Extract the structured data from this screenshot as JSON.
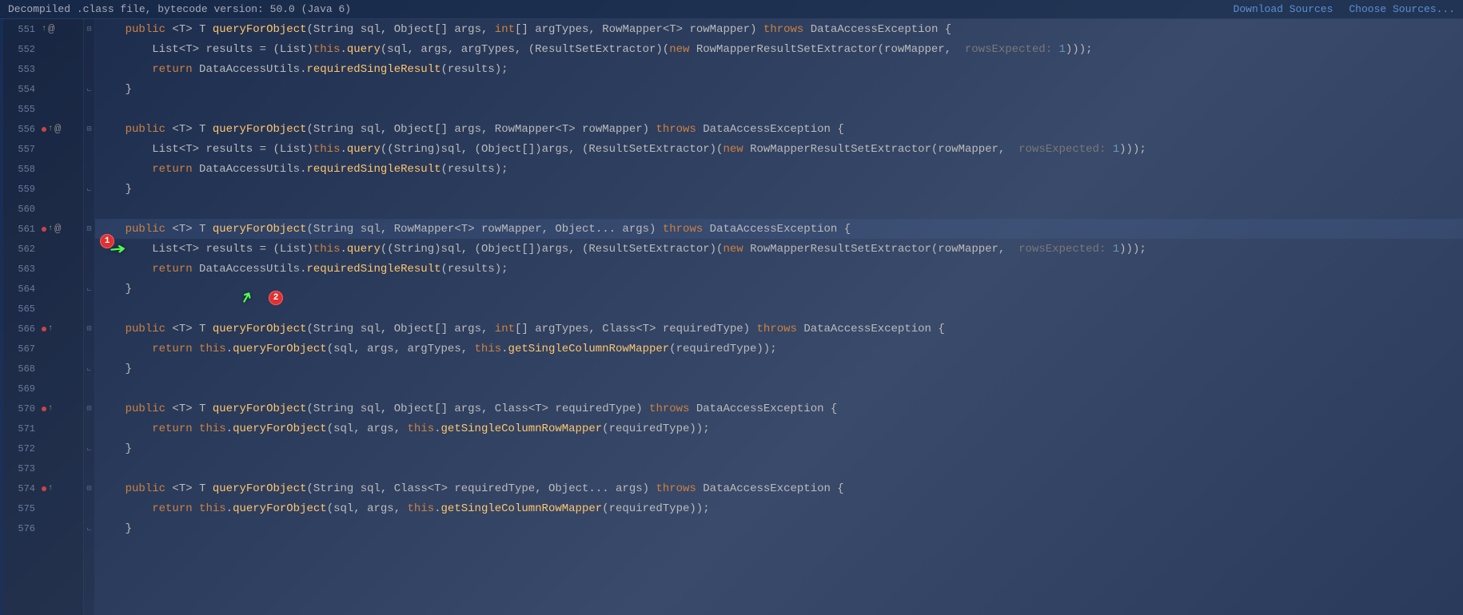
{
  "topbar": {
    "title": "Decompiled .class file, bytecode version: 50.0 (Java 6)",
    "download": "Download Sources",
    "choose": "Choose Sources..."
  },
  "annotations": {
    "badge1": "1",
    "badge2": "2"
  },
  "lines": [
    {
      "n": "551",
      "marks": [
        "green-arrow",
        "at"
      ],
      "fold": "minus",
      "code": [
        [
          "    ",
          ""
        ],
        [
          "public",
          "kw"
        ],
        [
          " <",
          ""
        ],
        [
          "T",
          "type"
        ],
        [
          "> ",
          ""
        ],
        [
          "T",
          "type"
        ],
        [
          " ",
          ""
        ],
        [
          "queryForObject",
          "method"
        ],
        [
          "(",
          ""
        ],
        [
          "String",
          "type"
        ],
        [
          " sql, ",
          ""
        ],
        [
          "Object",
          "type"
        ],
        [
          "[] args, ",
          ""
        ],
        [
          "int",
          "kw"
        ],
        [
          "[] argTypes, ",
          ""
        ],
        [
          "RowMapper",
          "type"
        ],
        [
          "<",
          ""
        ],
        [
          "T",
          "type"
        ],
        [
          "> rowMapper) ",
          ""
        ],
        [
          "throws",
          "kw"
        ],
        [
          " ",
          ""
        ],
        [
          "DataAccessException",
          "type"
        ],
        [
          " {",
          ""
        ]
      ]
    },
    {
      "n": "552",
      "marks": [],
      "fold": "",
      "code": [
        [
          "        ",
          ""
        ],
        [
          "List",
          "type"
        ],
        [
          "<",
          ""
        ],
        [
          "T",
          "type"
        ],
        [
          "> results = (",
          ""
        ],
        [
          "List",
          "type"
        ],
        [
          ")",
          ""
        ],
        [
          "this",
          "kw"
        ],
        [
          ".",
          ""
        ],
        [
          "query",
          "method"
        ],
        [
          "(sql, args, argTypes, (",
          ""
        ],
        [
          "ResultSetExtractor",
          "type"
        ],
        [
          ")(",
          ""
        ],
        [
          "new",
          "new"
        ],
        [
          " ",
          ""
        ],
        [
          "RowMapperResultSetExtractor",
          "type"
        ],
        [
          "(rowMapper,  ",
          ""
        ],
        [
          "rowsExpected: ",
          "hint"
        ],
        [
          "1",
          "generic"
        ],
        [
          ")));",
          ""
        ]
      ]
    },
    {
      "n": "553",
      "marks": [],
      "fold": "",
      "code": [
        [
          "        ",
          ""
        ],
        [
          "return",
          "kw"
        ],
        [
          " ",
          ""
        ],
        [
          "DataAccessUtils",
          "type"
        ],
        [
          ".",
          ""
        ],
        [
          "requiredSingleResult",
          "method"
        ],
        [
          "(results);",
          ""
        ]
      ]
    },
    {
      "n": "554",
      "marks": [],
      "fold": "end",
      "code": [
        [
          "    }",
          ""
        ]
      ]
    },
    {
      "n": "555",
      "marks": [],
      "fold": "",
      "code": [
        [
          "",
          ""
        ]
      ]
    },
    {
      "n": "556",
      "marks": [
        "red-dot",
        "green-arrow",
        "at"
      ],
      "fold": "minus",
      "code": [
        [
          "    ",
          ""
        ],
        [
          "public",
          "kw"
        ],
        [
          " <",
          ""
        ],
        [
          "T",
          "type"
        ],
        [
          "> ",
          ""
        ],
        [
          "T",
          "type"
        ],
        [
          " ",
          ""
        ],
        [
          "queryForObject",
          "method"
        ],
        [
          "(",
          ""
        ],
        [
          "String",
          "type"
        ],
        [
          " sql, ",
          ""
        ],
        [
          "Object",
          "type"
        ],
        [
          "[] args, ",
          ""
        ],
        [
          "RowMapper",
          "type"
        ],
        [
          "<",
          ""
        ],
        [
          "T",
          "type"
        ],
        [
          "> rowMapper) ",
          ""
        ],
        [
          "throws",
          "kw"
        ],
        [
          " ",
          ""
        ],
        [
          "DataAccessException",
          "type"
        ],
        [
          " {",
          ""
        ]
      ]
    },
    {
      "n": "557",
      "marks": [],
      "fold": "",
      "code": [
        [
          "        ",
          ""
        ],
        [
          "List",
          "type"
        ],
        [
          "<",
          ""
        ],
        [
          "T",
          "type"
        ],
        [
          "> results = (",
          ""
        ],
        [
          "List",
          "type"
        ],
        [
          ")",
          ""
        ],
        [
          "this",
          "kw"
        ],
        [
          ".",
          ""
        ],
        [
          "query",
          "method"
        ],
        [
          "((",
          ""
        ],
        [
          "String",
          "type"
        ],
        [
          ")sql, (",
          ""
        ],
        [
          "Object",
          "type"
        ],
        [
          "[])args, (",
          ""
        ],
        [
          "ResultSetExtractor",
          "type"
        ],
        [
          ")(",
          ""
        ],
        [
          "new",
          "new"
        ],
        [
          " ",
          ""
        ],
        [
          "RowMapperResultSetExtractor",
          "type"
        ],
        [
          "(rowMapper,  ",
          ""
        ],
        [
          "rowsExpected: ",
          "hint"
        ],
        [
          "1",
          "generic"
        ],
        [
          ")));",
          ""
        ]
      ]
    },
    {
      "n": "558",
      "marks": [],
      "fold": "",
      "code": [
        [
          "        ",
          ""
        ],
        [
          "return",
          "kw"
        ],
        [
          " ",
          ""
        ],
        [
          "DataAccessUtils",
          "type"
        ],
        [
          ".",
          ""
        ],
        [
          "requiredSingleResult",
          "method"
        ],
        [
          "(results);",
          ""
        ]
      ]
    },
    {
      "n": "559",
      "marks": [],
      "fold": "end",
      "code": [
        [
          "    }",
          ""
        ]
      ]
    },
    {
      "n": "560",
      "marks": [],
      "fold": "",
      "code": [
        [
          "",
          ""
        ]
      ]
    },
    {
      "n": "561",
      "marks": [
        "red-dot",
        "green-arrow",
        "at"
      ],
      "fold": "minus",
      "current": true,
      "code": [
        [
          "    ",
          ""
        ],
        [
          "public",
          "kw"
        ],
        [
          " <",
          ""
        ],
        [
          "T",
          "type"
        ],
        [
          "> ",
          ""
        ],
        [
          "T",
          "type"
        ],
        [
          " ",
          ""
        ],
        [
          "queryForObject",
          "method"
        ],
        [
          "(",
          ""
        ],
        [
          "String",
          "type"
        ],
        [
          " sql, ",
          ""
        ],
        [
          "RowMapper",
          "type"
        ],
        [
          "<",
          ""
        ],
        [
          "T",
          "type"
        ],
        [
          "> rowMapper, ",
          ""
        ],
        [
          "Object",
          "type"
        ],
        [
          "... args) ",
          ""
        ],
        [
          "throws",
          "kw"
        ],
        [
          " ",
          ""
        ],
        [
          "DataAccessException",
          "type"
        ],
        [
          " {",
          ""
        ]
      ]
    },
    {
      "n": "562",
      "marks": [],
      "fold": "",
      "code": [
        [
          "        ",
          ""
        ],
        [
          "List",
          "type"
        ],
        [
          "<",
          ""
        ],
        [
          "T",
          "type"
        ],
        [
          "> results = (",
          ""
        ],
        [
          "List",
          "type"
        ],
        [
          ")",
          ""
        ],
        [
          "this",
          "kw"
        ],
        [
          ".",
          ""
        ],
        [
          "query",
          "method"
        ],
        [
          "((",
          ""
        ],
        [
          "String",
          "type"
        ],
        [
          ")sql, (",
          ""
        ],
        [
          "Object",
          "type"
        ],
        [
          "[])args, (",
          ""
        ],
        [
          "ResultSetExtractor",
          "type"
        ],
        [
          ")(",
          ""
        ],
        [
          "new",
          "new"
        ],
        [
          " ",
          ""
        ],
        [
          "RowMapperResultSetExtractor",
          "type"
        ],
        [
          "(rowMapper,  ",
          ""
        ],
        [
          "rowsExpected: ",
          "hint"
        ],
        [
          "1",
          "generic"
        ],
        [
          ")));",
          ""
        ]
      ]
    },
    {
      "n": "563",
      "marks": [],
      "fold": "",
      "code": [
        [
          "        ",
          ""
        ],
        [
          "return",
          "kw"
        ],
        [
          " ",
          ""
        ],
        [
          "DataAccessUtils",
          "type"
        ],
        [
          ".",
          ""
        ],
        [
          "requiredSingleResult",
          "method"
        ],
        [
          "(results);",
          ""
        ]
      ]
    },
    {
      "n": "564",
      "marks": [],
      "fold": "end",
      "code": [
        [
          "    }",
          ""
        ]
      ]
    },
    {
      "n": "565",
      "marks": [],
      "fold": "",
      "code": [
        [
          "",
          ""
        ]
      ]
    },
    {
      "n": "566",
      "marks": [
        "red-dot",
        "green-arrow"
      ],
      "fold": "minus",
      "code": [
        [
          "    ",
          ""
        ],
        [
          "public",
          "kw"
        ],
        [
          " <",
          ""
        ],
        [
          "T",
          "type"
        ],
        [
          "> ",
          ""
        ],
        [
          "T",
          "type"
        ],
        [
          " ",
          ""
        ],
        [
          "queryForObject",
          "method"
        ],
        [
          "(",
          ""
        ],
        [
          "String",
          "type"
        ],
        [
          " sql, ",
          ""
        ],
        [
          "Object",
          "type"
        ],
        [
          "[] args, ",
          ""
        ],
        [
          "int",
          "kw"
        ],
        [
          "[] argTypes, ",
          ""
        ],
        [
          "Class",
          "type"
        ],
        [
          "<",
          ""
        ],
        [
          "T",
          "type"
        ],
        [
          "> requiredType) ",
          ""
        ],
        [
          "throws",
          "kw"
        ],
        [
          " ",
          ""
        ],
        [
          "DataAccessException",
          "type"
        ],
        [
          " {",
          ""
        ]
      ]
    },
    {
      "n": "567",
      "marks": [],
      "fold": "",
      "code": [
        [
          "        ",
          ""
        ],
        [
          "return",
          "kw"
        ],
        [
          " ",
          ""
        ],
        [
          "this",
          "kw"
        ],
        [
          ".",
          ""
        ],
        [
          "queryForObject",
          "method"
        ],
        [
          "(sql, args, argTypes, ",
          ""
        ],
        [
          "this",
          "kw"
        ],
        [
          ".",
          ""
        ],
        [
          "getSingleColumnRowMapper",
          "method"
        ],
        [
          "(requiredType));",
          ""
        ]
      ]
    },
    {
      "n": "568",
      "marks": [],
      "fold": "end",
      "code": [
        [
          "    }",
          ""
        ]
      ]
    },
    {
      "n": "569",
      "marks": [],
      "fold": "",
      "code": [
        [
          "",
          ""
        ]
      ]
    },
    {
      "n": "570",
      "marks": [
        "red-dot",
        "green-arrow"
      ],
      "fold": "minus",
      "code": [
        [
          "    ",
          ""
        ],
        [
          "public",
          "kw"
        ],
        [
          " <",
          ""
        ],
        [
          "T",
          "type"
        ],
        [
          "> ",
          ""
        ],
        [
          "T",
          "type"
        ],
        [
          " ",
          ""
        ],
        [
          "queryForObject",
          "method"
        ],
        [
          "(",
          ""
        ],
        [
          "String",
          "type"
        ],
        [
          " sql, ",
          ""
        ],
        [
          "Object",
          "type"
        ],
        [
          "[] args, ",
          ""
        ],
        [
          "Class",
          "type"
        ],
        [
          "<",
          ""
        ],
        [
          "T",
          "type"
        ],
        [
          "> requiredType) ",
          ""
        ],
        [
          "throws",
          "kw"
        ],
        [
          " ",
          ""
        ],
        [
          "DataAccessException",
          "type"
        ],
        [
          " {",
          ""
        ]
      ]
    },
    {
      "n": "571",
      "marks": [],
      "fold": "",
      "code": [
        [
          "        ",
          ""
        ],
        [
          "return",
          "kw"
        ],
        [
          " ",
          ""
        ],
        [
          "this",
          "kw"
        ],
        [
          ".",
          ""
        ],
        [
          "queryForObject",
          "method"
        ],
        [
          "(sql, args, ",
          ""
        ],
        [
          "this",
          "kw"
        ],
        [
          ".",
          ""
        ],
        [
          "getSingleColumnRowMapper",
          "method"
        ],
        [
          "(requiredType));",
          ""
        ]
      ]
    },
    {
      "n": "572",
      "marks": [],
      "fold": "end",
      "code": [
        [
          "    }",
          ""
        ]
      ]
    },
    {
      "n": "573",
      "marks": [],
      "fold": "",
      "code": [
        [
          "",
          ""
        ]
      ]
    },
    {
      "n": "574",
      "marks": [
        "red-dot",
        "green-arrow"
      ],
      "fold": "minus",
      "code": [
        [
          "    ",
          ""
        ],
        [
          "public",
          "kw"
        ],
        [
          " <",
          ""
        ],
        [
          "T",
          "type"
        ],
        [
          "> ",
          ""
        ],
        [
          "T",
          "type"
        ],
        [
          " ",
          ""
        ],
        [
          "queryForObject",
          "method"
        ],
        [
          "(",
          ""
        ],
        [
          "String",
          "type"
        ],
        [
          " sql, ",
          ""
        ],
        [
          "Class",
          "type"
        ],
        [
          "<",
          ""
        ],
        [
          "T",
          "type"
        ],
        [
          "> requiredType, ",
          ""
        ],
        [
          "Object",
          "type"
        ],
        [
          "... args) ",
          ""
        ],
        [
          "throws",
          "kw"
        ],
        [
          " ",
          ""
        ],
        [
          "DataAccessException",
          "type"
        ],
        [
          " {",
          ""
        ]
      ]
    },
    {
      "n": "575",
      "marks": [],
      "fold": "",
      "code": [
        [
          "        ",
          ""
        ],
        [
          "return",
          "kw"
        ],
        [
          " ",
          ""
        ],
        [
          "this",
          "kw"
        ],
        [
          ".",
          ""
        ],
        [
          "queryForObject",
          "method"
        ],
        [
          "(sql, args, ",
          ""
        ],
        [
          "this",
          "kw"
        ],
        [
          ".",
          ""
        ],
        [
          "getSingleColumnRowMapper",
          "method"
        ],
        [
          "(requiredType));",
          ""
        ]
      ]
    },
    {
      "n": "576",
      "marks": [],
      "fold": "end",
      "code": [
        [
          "    }",
          ""
        ]
      ]
    }
  ]
}
